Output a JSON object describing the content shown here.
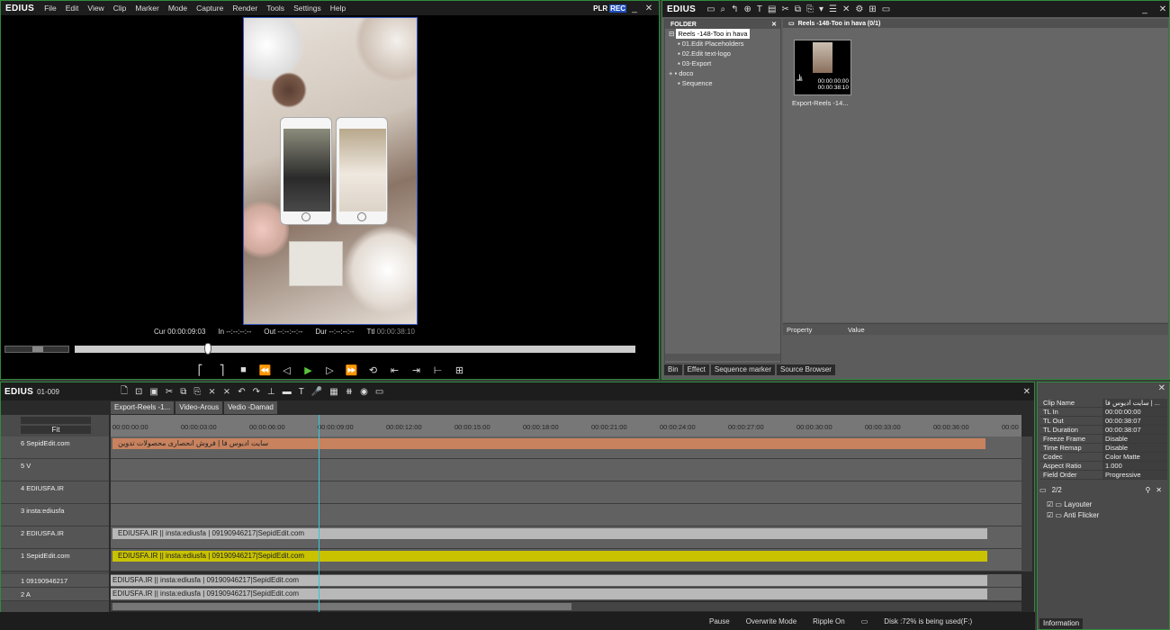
{
  "menubar": {
    "logo": "EDIUS",
    "items": [
      "File",
      "Edit",
      "View",
      "Clip",
      "Marker",
      "Mode",
      "Capture",
      "Render",
      "Tools",
      "Settings",
      "Help"
    ],
    "plr": "PLR",
    "rec": "REC"
  },
  "timecode": {
    "cur_label": "Cur",
    "cur": "00:00:09:03",
    "in_label": "In",
    "in": "--:--:--:--",
    "out_label": "Out",
    "out": "--:--:--:--",
    "dur_label": "Dur",
    "dur": "--:--:--:--",
    "ttl_label": "Ttl",
    "ttl": "00:00:38:10"
  },
  "bin": {
    "logo": "EDIUS",
    "folder_header": "FOLDER",
    "tree": [
      "Reels -148-Too in hava",
      "01.Edit Placeholders",
      "02.Edit text-logo",
      "03-Export",
      "doco",
      "Sequence"
    ],
    "clips_header": "Reels -148-Too in hava (0/1)",
    "clip_tc1": "00:00:00:00",
    "clip_tc2": "00:00:38:10",
    "clip_name": "Export-Reels -14...",
    "prop_headers": [
      "Property",
      "Value"
    ],
    "tabs": [
      "Bin",
      "Effect",
      "Sequence marker",
      "Source Browser"
    ]
  },
  "timeline": {
    "logo": "EDIUS",
    "seq_id": "01-009",
    "fit": "Fit",
    "seq_tabs": [
      "Export-Reels -1...",
      "Video-Arous",
      "Vedio -Damad"
    ],
    "ticks": [
      "00:00:00:00",
      "00:00:03:00",
      "00:00:06:00",
      "00:00:09:00",
      "00:00:12:00",
      "00:00:15:00",
      "00:00:18:00",
      "00:00:21:00",
      "00:00:24:00",
      "00:00:27:00",
      "00:00:30:00",
      "00:00:33:00",
      "00:00:36:00",
      "00:00"
    ],
    "tracks": [
      "6 SepidEdit.com",
      "5 V",
      "4 EDIUSFA.IR",
      "3 insta:ediusfa",
      "2 EDIUSFA.IR",
      "1 SepidEdit.com",
      "1 09190946217",
      "2 A"
    ],
    "clip_title": "سایت ادیوس فا | فروش انحصاری محصولات تدوین",
    "clip_text": "EDIUSFA.IR || insta:ediusfa |  09190946217|SepidEdit.com",
    "clip_text_b": "EDIUSFA.IR || insta:ediusfa |  09190946217|SepidEdit.com"
  },
  "info": {
    "rows": [
      [
        "Clip Name",
        "سایت ادیوس فا | ..."
      ],
      [
        "TL In",
        "00:00:00:00"
      ],
      [
        "TL Out",
        "00:00:38:07"
      ],
      [
        "TL Duration",
        "00:00:38:07"
      ],
      [
        "Freeze Frame",
        "Disable"
      ],
      [
        "Time Remap",
        "Disable"
      ],
      [
        "Codec",
        "Color Matte"
      ],
      [
        "Aspect Ratio",
        "1.000"
      ],
      [
        "Field Order",
        "Progressive"
      ]
    ],
    "count": "2/2",
    "filters": [
      "Layouter",
      "Anti Flicker"
    ],
    "tab": "Information"
  },
  "status": {
    "pause": "Pause",
    "overwrite": "Overwrite Mode",
    "ripple": "Ripple On",
    "disk": "Disk :72% is being used(F:)"
  },
  "colors": {
    "accent_border": "#2f8a3c",
    "clip_orange": "#c8825e",
    "clip_yellow": "#c8c200",
    "clip_gray": "#b8b8b8",
    "playhead": "#39c7d8",
    "play_green": "#5bc23b"
  }
}
